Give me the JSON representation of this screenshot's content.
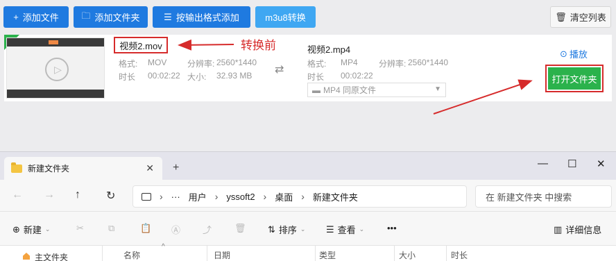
{
  "toolbar": {
    "add_file": "添加文件",
    "add_folder": "添加文件夹",
    "add_by_format": "按输出格式添加",
    "m3u8": "m3u8转换",
    "clear_list": "清空列表"
  },
  "annotation": {
    "before_label": "转换前"
  },
  "source": {
    "filename": "视频2.mov",
    "format_label": "格式:",
    "format": "MOV",
    "resolution_label": "分辨率:",
    "resolution": "2560*1440",
    "duration_label": "时长",
    "duration": "00:02:22",
    "size_label": "大小:",
    "size": "32.93 MB"
  },
  "output": {
    "filename": "视频2.mp4",
    "format_label": "格式:",
    "format": "MP4",
    "resolution_label": "分辨率:",
    "resolution": "2560*1440",
    "duration_label": "时长",
    "duration": "00:02:22",
    "preset": "MP4  同原文件"
  },
  "actions": {
    "play": "播放",
    "open_folder": "打开文件夹"
  },
  "explorer": {
    "tab_title": "新建文件夹",
    "path": {
      "p1": "用户",
      "p2": "yssoft2",
      "p3": "桌面",
      "p4": "新建文件夹"
    },
    "search_placeholder": "在 新建文件夹 中搜索",
    "commands": {
      "new": "新建",
      "sort": "排序",
      "view": "查看",
      "details": "详细信息"
    },
    "nav_pane": "主文件夹",
    "columns": {
      "name": "名称",
      "date": "日期",
      "type": "类型",
      "size": "大小",
      "duration": "时长"
    }
  },
  "colors": {
    "primary_blue": "#1f7ae0",
    "light_blue": "#3fa7f2",
    "green": "#2bb24c",
    "annotation_red": "#d62b2b"
  }
}
